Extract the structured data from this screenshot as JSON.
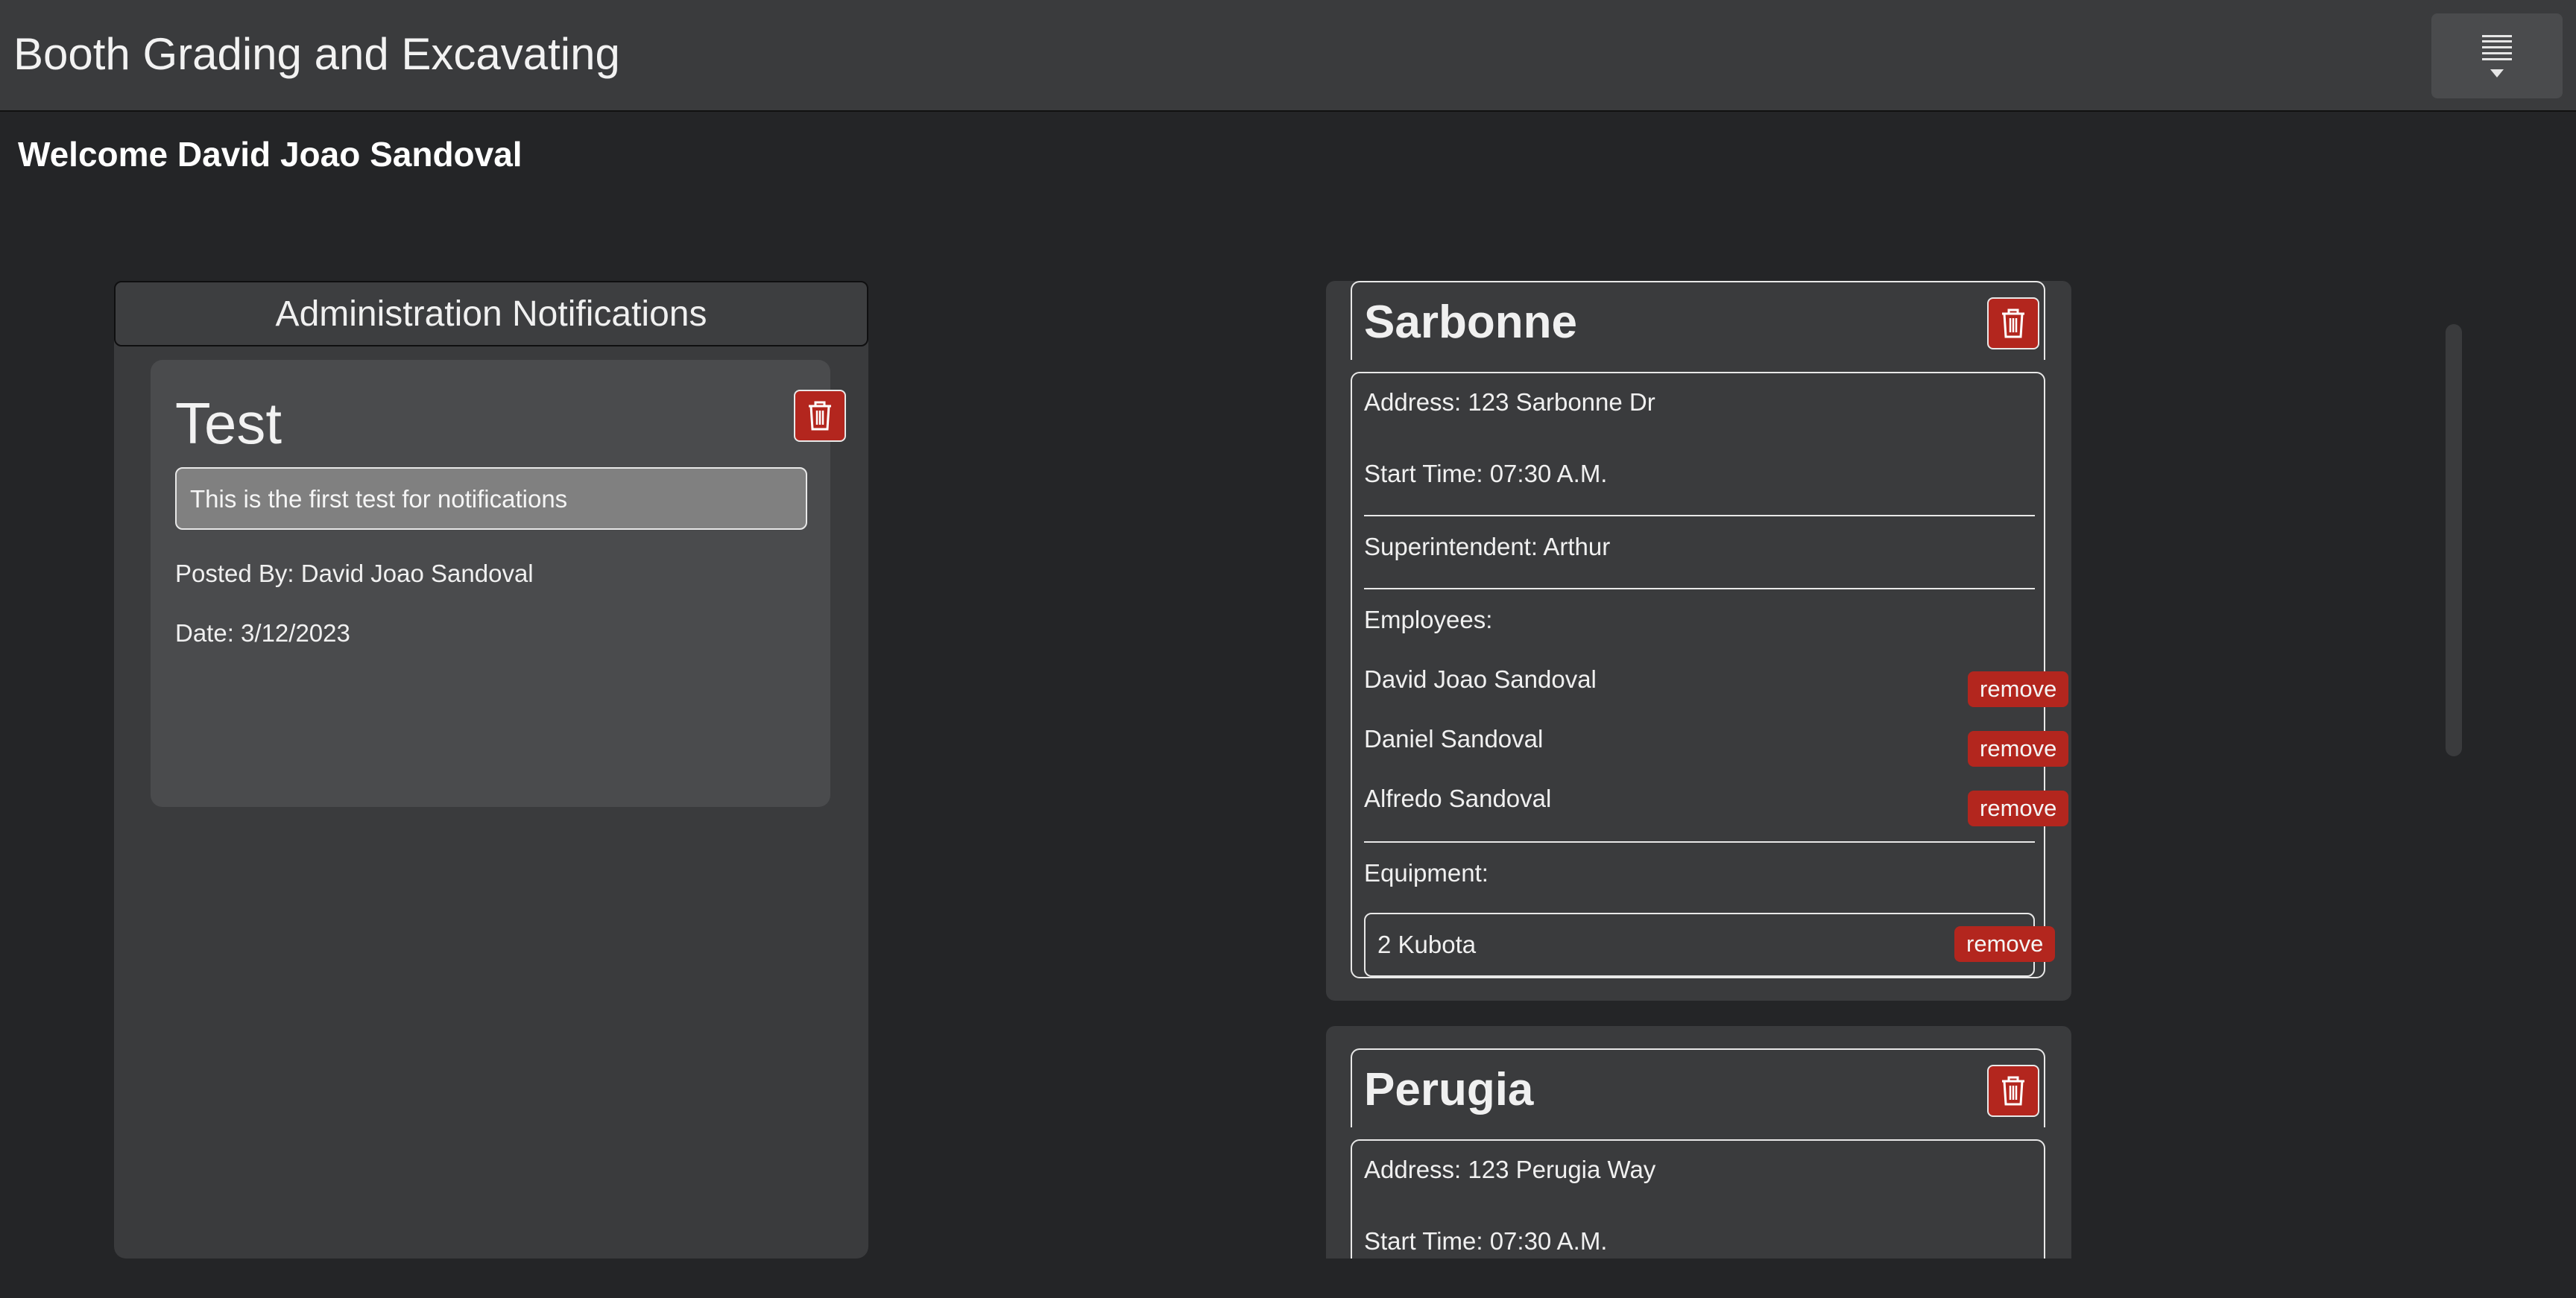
{
  "app": {
    "title": "Booth Grading and Excavating",
    "menu_icon": "hamburger-dropdown-icon"
  },
  "welcome": "Welcome David Joao Sandoval",
  "admin": {
    "heading": "Administration Notifications",
    "notification": {
      "title": "Test",
      "message": "This is the first test for notifications",
      "posted_by": "Posted By: David Joao Sandoval",
      "date": "Date: 3/12/2023"
    }
  },
  "jobs": [
    {
      "name": "Sarbonne",
      "address": "Address: 123 Sarbonne Dr",
      "start_time": "Start Time: 07:30 A.M.",
      "superintendent": "Superintendent: Arthur",
      "employees_label": "Employees:",
      "employees": [
        "David Joao Sandoval",
        "Daniel Sandoval",
        "Alfredo Sandoval"
      ],
      "equipment_label": "Equipment:",
      "equipment": [
        "2 Kubota"
      ],
      "remove_label": "remove"
    },
    {
      "name": "Perugia",
      "address": "Address: 123 Perugia Way",
      "start_time": "Start Time: 07:30 A.M."
    }
  ],
  "colors": {
    "danger": "#b3261e",
    "panel": "#3a3b3d",
    "background": "#242527"
  }
}
